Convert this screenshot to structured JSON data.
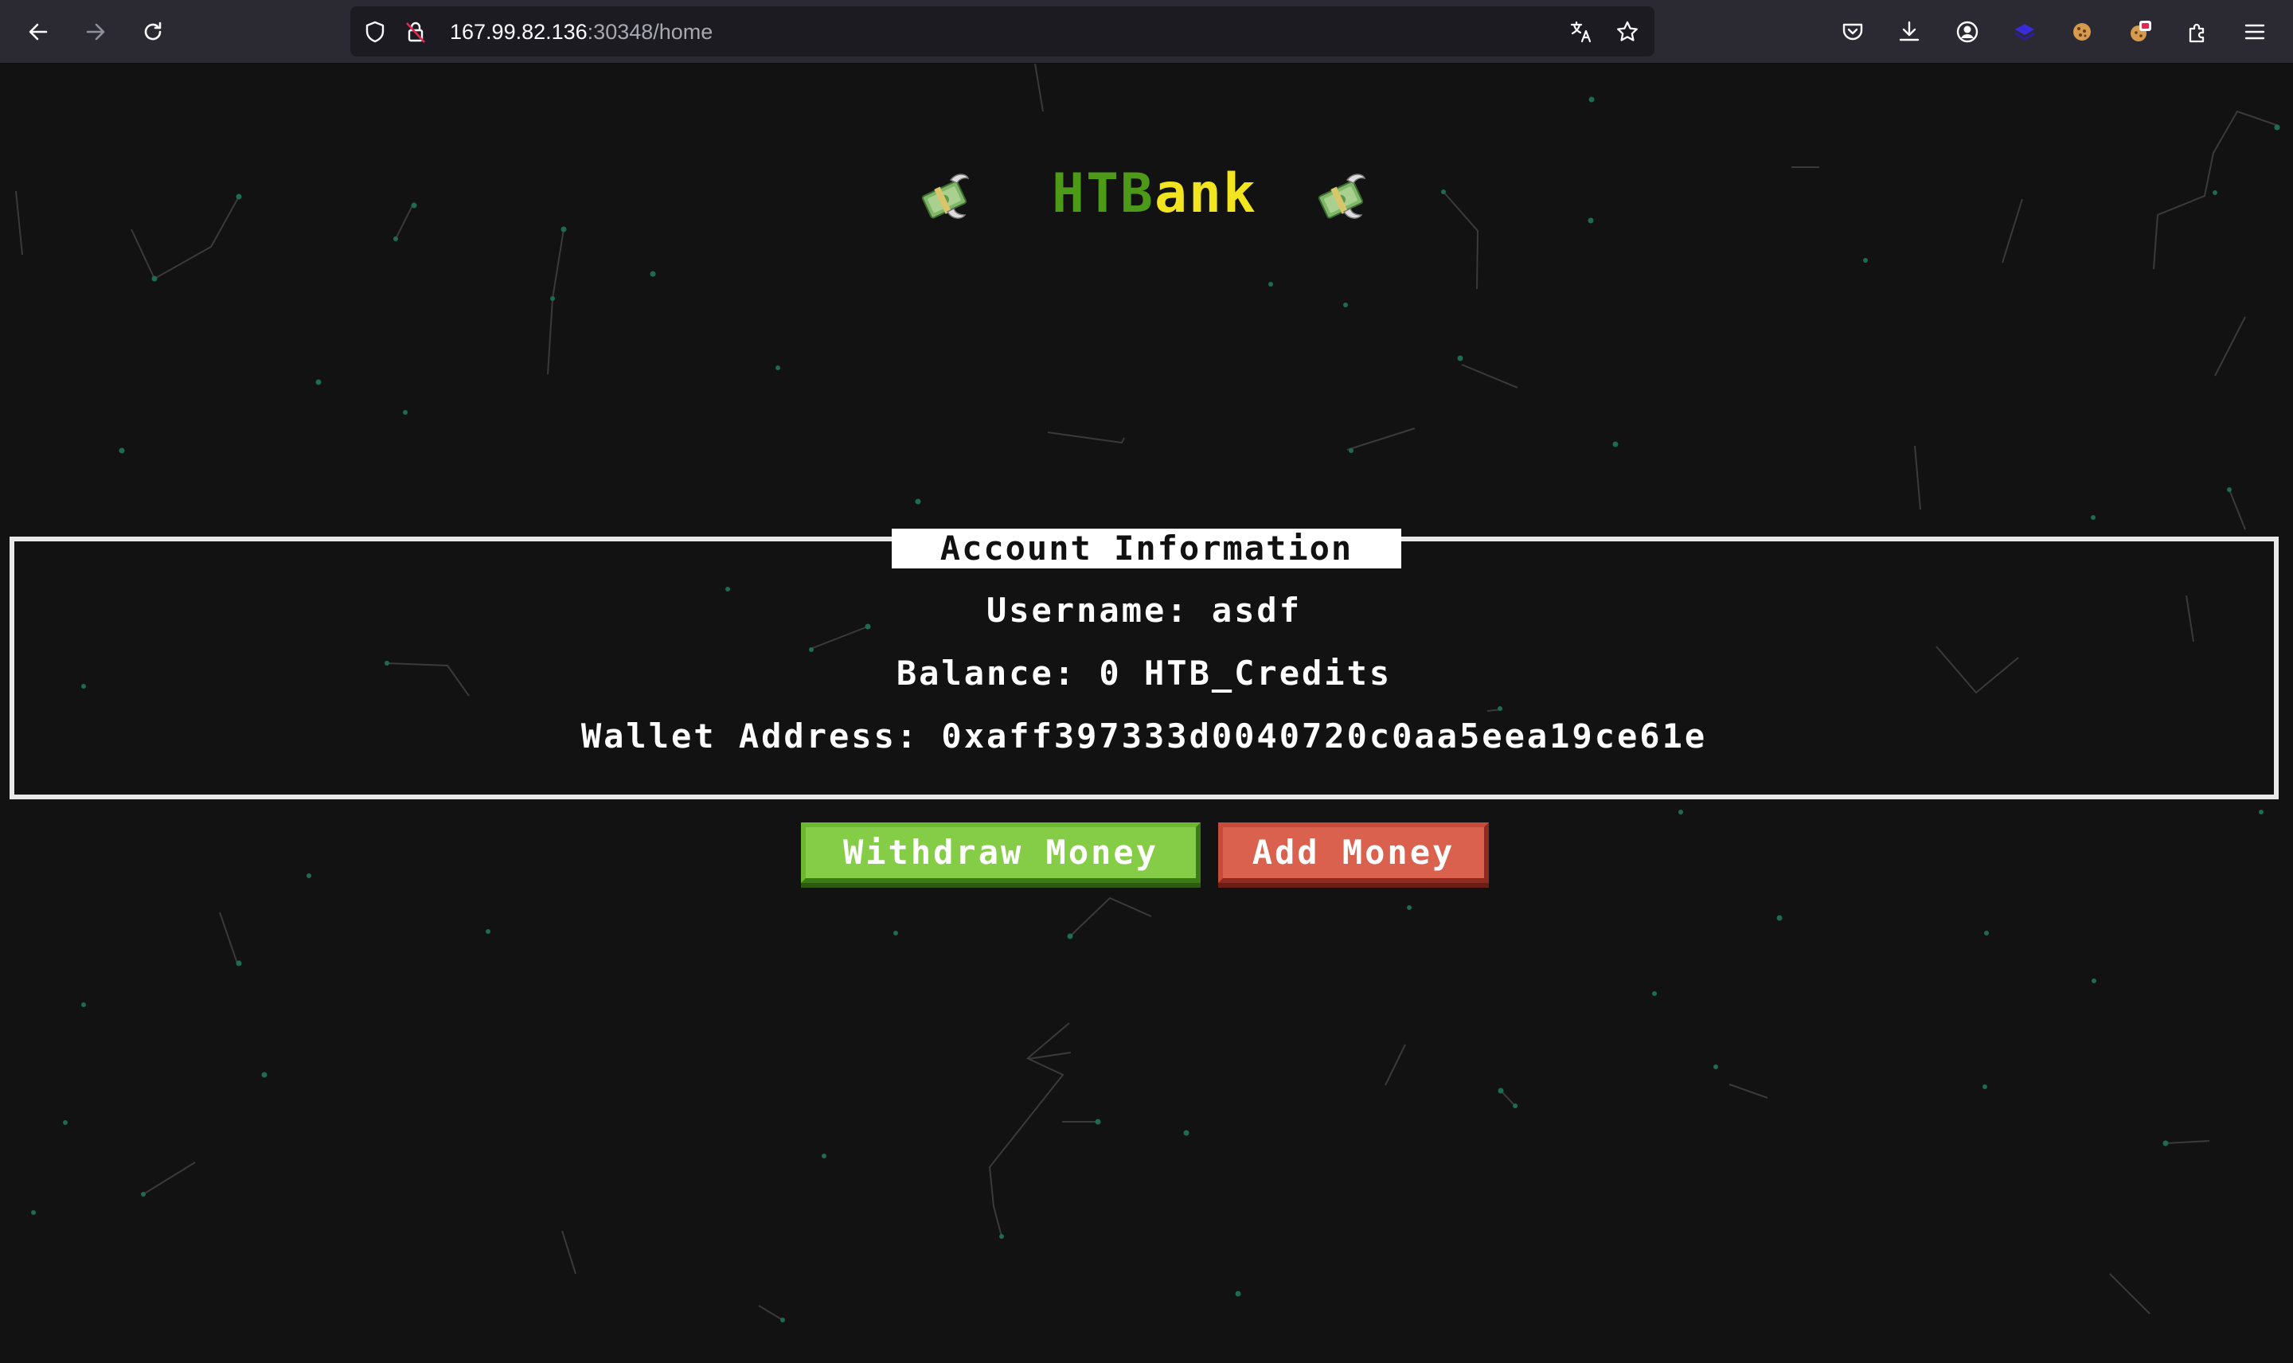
{
  "browser": {
    "url_host": "167.99.82.136",
    "url_rest": ":30348/home",
    "icons": [
      "back-icon",
      "forward-icon",
      "reload-icon",
      "shield-icon",
      "lock-insecure-icon",
      "translate-icon",
      "star-icon",
      "pocket-icon",
      "download-icon",
      "account-icon",
      "extension-layers-icon",
      "cookie-icon",
      "extension-badge-icon",
      "extensions-puzzle-icon",
      "menu-icon"
    ]
  },
  "brand": {
    "title_part1": "HTB",
    "title_part2": "ank",
    "emoji": "money-with-wings"
  },
  "account": {
    "heading": "Account Information",
    "username_line": "Username: asdf",
    "balance_line": "Balance: 0 HTB_Credits",
    "wallet_line": "Wallet Address: 0xaff397333d0040720c0aa5eea19ce61e"
  },
  "actions": {
    "withdraw_label": "Withdraw Money",
    "add_label": "Add Money"
  },
  "colors": {
    "background": "#121212",
    "title_green": "#4c9a18",
    "title_yellow": "#f2e41f",
    "withdraw_green": "#86cd47",
    "add_red": "#d9614d",
    "dots": "#1d6b55"
  }
}
